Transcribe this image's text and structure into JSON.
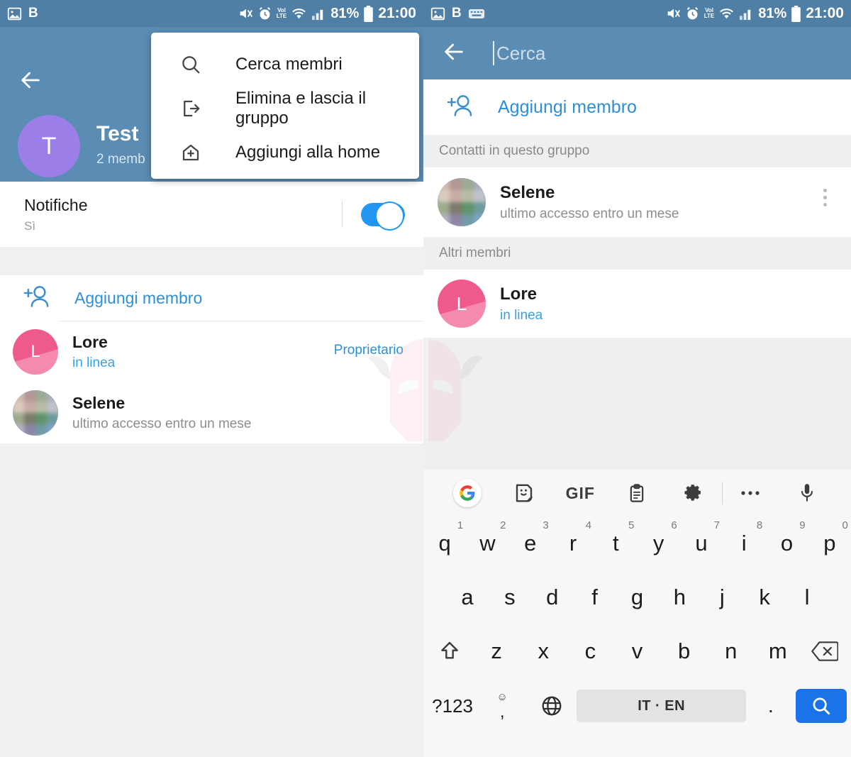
{
  "statusbar": {
    "left_icons": [
      "image-icon",
      "bold-b-icon"
    ],
    "left_label": "B",
    "right_label": "B",
    "right_icons": [
      "image-icon",
      "bold-b-icon",
      "keyboard-icon"
    ],
    "mute_icon": "mute-icon",
    "alarm_icon": "alarm-icon",
    "volte_line1": "VoLTE",
    "volte_top": "Vol",
    "volte_bottom": "LTE",
    "wifi_icon": "wifi-icon",
    "signal_icon": "signal-icon",
    "battery_pct": "81%",
    "battery_icon": "battery-icon",
    "time": "21:00"
  },
  "left": {
    "back_icon": "back-arrow-icon",
    "group": {
      "avatar_initial": "T",
      "avatar_color": "#9b7ee8",
      "name": "Test",
      "members_count": "2 memb"
    },
    "menu": {
      "items": [
        {
          "label": "Cerca membri",
          "icon": "search-icon"
        },
        {
          "label": "Elimina e lascia il gruppo",
          "icon": "exit-icon"
        },
        {
          "label": "Aggiungi alla home",
          "icon": "add-to-home-icon"
        }
      ]
    },
    "notifications": {
      "title": "Notifiche",
      "value": "Sì",
      "toggle_on": true,
      "toggle_color": "#2196f3"
    },
    "add_member": {
      "label": "Aggiungi membro",
      "icon": "add-person-icon",
      "color": "#2d8fd5"
    },
    "members": [
      {
        "name": "Lore",
        "status": "in linea",
        "status_type": "online",
        "role": "Proprietario",
        "avatar_initial": "L",
        "avatar_color": "#ef5a8c",
        "avatar_type": "initial"
      },
      {
        "name": "Selene",
        "status": "ultimo accesso entro un mese",
        "status_type": "offline",
        "role": "",
        "avatar_initial": "",
        "avatar_color": "#9aa7b4",
        "avatar_type": "photo"
      }
    ]
  },
  "right": {
    "back_icon": "back-arrow-icon",
    "search": {
      "placeholder": "Cerca",
      "value": ""
    },
    "add_member": {
      "label": "Aggiungi membro",
      "icon": "add-person-icon",
      "color": "#2d8fd5"
    },
    "sections": [
      {
        "header": "Contatti in questo gruppo",
        "rows": [
          {
            "name": "Selene",
            "status": "ultimo accesso entro un mese",
            "status_type": "offline",
            "avatar_initial": "",
            "avatar_color": "#9aa7b4",
            "avatar_type": "photo",
            "overflow_icon": "more-vertical-icon"
          }
        ]
      },
      {
        "header": "Altri membri",
        "rows": [
          {
            "name": "Lore",
            "status": "in linea",
            "status_type": "online",
            "avatar_initial": "L",
            "avatar_color": "#ef5a8c",
            "avatar_type": "initial",
            "overflow_icon": ""
          }
        ]
      }
    ]
  },
  "keyboard": {
    "toolbar": [
      {
        "name": "google-icon",
        "label": "G"
      },
      {
        "name": "sticker-icon",
        "label": ""
      },
      {
        "name": "gif-icon",
        "label": "GIF"
      },
      {
        "name": "clipboard-icon",
        "label": ""
      },
      {
        "name": "settings-gear-icon",
        "label": ""
      },
      {
        "name": "more-horizontal-icon",
        "label": ""
      },
      {
        "name": "microphone-icon",
        "label": ""
      }
    ],
    "row1": [
      {
        "key": "q",
        "num": "1"
      },
      {
        "key": "w",
        "num": "2"
      },
      {
        "key": "e",
        "num": "3"
      },
      {
        "key": "r",
        "num": "4"
      },
      {
        "key": "t",
        "num": "5"
      },
      {
        "key": "y",
        "num": "6"
      },
      {
        "key": "u",
        "num": "7"
      },
      {
        "key": "i",
        "num": "8"
      },
      {
        "key": "o",
        "num": "9"
      },
      {
        "key": "p",
        "num": "0"
      }
    ],
    "row2": [
      "a",
      "s",
      "d",
      "f",
      "g",
      "h",
      "j",
      "k",
      "l"
    ],
    "row3": [
      "z",
      "x",
      "c",
      "v",
      "b",
      "n",
      "m"
    ],
    "shift_icon": "shift-icon",
    "backspace_icon": "backspace-icon",
    "symbols_key": "?123",
    "emoji_key": "☺",
    "comma_key": ",",
    "language_icon": "globe-icon",
    "spacebar_label": "IT · EN",
    "period_key": ".",
    "enter_icon": "search-icon",
    "enter_color": "#1a73e8"
  },
  "watermark": {
    "name": "viking-helmet-watermark"
  }
}
